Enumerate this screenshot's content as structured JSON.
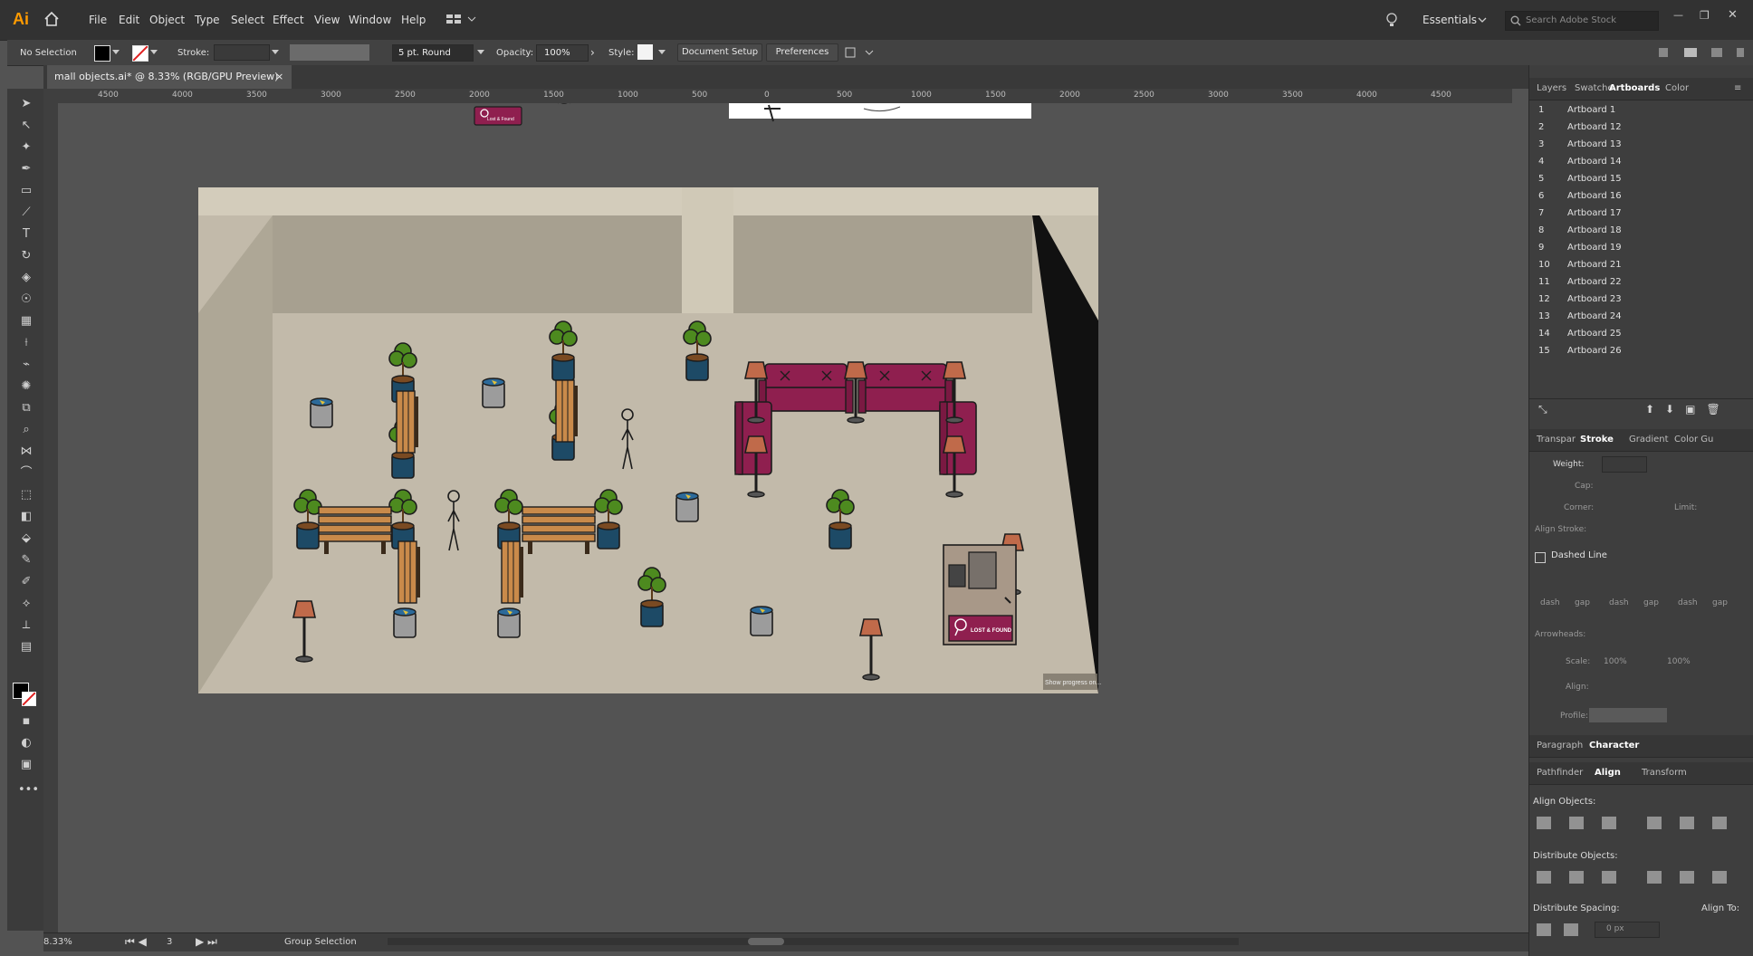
{
  "app": {
    "logo": "Ai",
    "workspace": "Essentials",
    "search_placeholder": "Search Adobe Stock"
  },
  "menu": [
    "File",
    "Edit",
    "Object",
    "Type",
    "Select",
    "Effect",
    "View",
    "Window",
    "Help"
  ],
  "control_bar": {
    "selection": "No Selection",
    "stroke_label": "Stroke:",
    "brush": "5 pt. Round",
    "opacity_label": "Opacity:",
    "opacity_value": "100%",
    "style_label": "Style:",
    "document_setup": "Document Setup",
    "preferences": "Preferences"
  },
  "document_tab": {
    "title": "mall objects.ai* @ 8.33% (RGB/GPU Preview)",
    "close": "×"
  },
  "ruler": {
    "labels": [
      "4500",
      "4000",
      "3500",
      "3000",
      "2500",
      "2000",
      "1500",
      "1000",
      "500",
      "0",
      "500",
      "1000",
      "1500",
      "2000",
      "2500",
      "3000",
      "3500",
      "4000",
      "4500"
    ]
  },
  "canvas": {
    "lost_found_small": "Lost & Found",
    "lost_found_counter": "LOST & FOUND",
    "tooltip": "Show progress on..."
  },
  "status": {
    "zoom": "8.33%",
    "artboard_num": "3",
    "tool": "Group Selection"
  },
  "panels": {
    "top_tabs": [
      "Layers",
      "Swatche",
      "Artboards",
      "Color"
    ],
    "artboards": [
      {
        "n": "1",
        "name": "Artboard 1"
      },
      {
        "n": "2",
        "name": "Artboard 12"
      },
      {
        "n": "3",
        "name": "Artboard 13"
      },
      {
        "n": "4",
        "name": "Artboard 14"
      },
      {
        "n": "5",
        "name": "Artboard 15"
      },
      {
        "n": "6",
        "name": "Artboard 16"
      },
      {
        "n": "7",
        "name": "Artboard 17"
      },
      {
        "n": "8",
        "name": "Artboard 18"
      },
      {
        "n": "9",
        "name": "Artboard 19"
      },
      {
        "n": "10",
        "name": "Artboard 21"
      },
      {
        "n": "11",
        "name": "Artboard 22"
      },
      {
        "n": "12",
        "name": "Artboard 23"
      },
      {
        "n": "13",
        "name": "Artboard 24"
      },
      {
        "n": "14",
        "name": "Artboard 25"
      },
      {
        "n": "15",
        "name": "Artboard 26"
      }
    ],
    "stroke_tabs": [
      "Transpar",
      "Stroke",
      "Gradient",
      "Color Gu"
    ],
    "stroke": {
      "weight": "Weight:",
      "cap": "Cap:",
      "corner": "Corner:",
      "limit": "Limit:",
      "align_stroke": "Align Stroke:",
      "dashed_line": "Dashed Line",
      "dash_labels": [
        "dash",
        "gap",
        "dash",
        "gap",
        "dash",
        "gap"
      ],
      "arrowheads": "Arrowheads:",
      "scale": "Scale:",
      "scale_val": "100%",
      "align": "Align:",
      "profile": "Profile:"
    },
    "char_tabs": [
      "Paragraph",
      "Character"
    ],
    "align_tabs": [
      "Pathfinder",
      "Align",
      "Transform"
    ],
    "align": {
      "align_objects": "Align Objects:",
      "distribute_objects": "Distribute Objects:",
      "distribute_spacing": "Distribute Spacing:",
      "align_to": "Align To:",
      "spacing_val": "0 px"
    }
  },
  "colors": {
    "accent": "#ff9a00",
    "sofa": "#8f1f4f",
    "pot": "#1d4a66",
    "plant": "#4d8a1f",
    "bench": "#c98a4a",
    "lamp": "#c06a4a",
    "floor": "#c2baaa",
    "wall": "#aea897"
  }
}
